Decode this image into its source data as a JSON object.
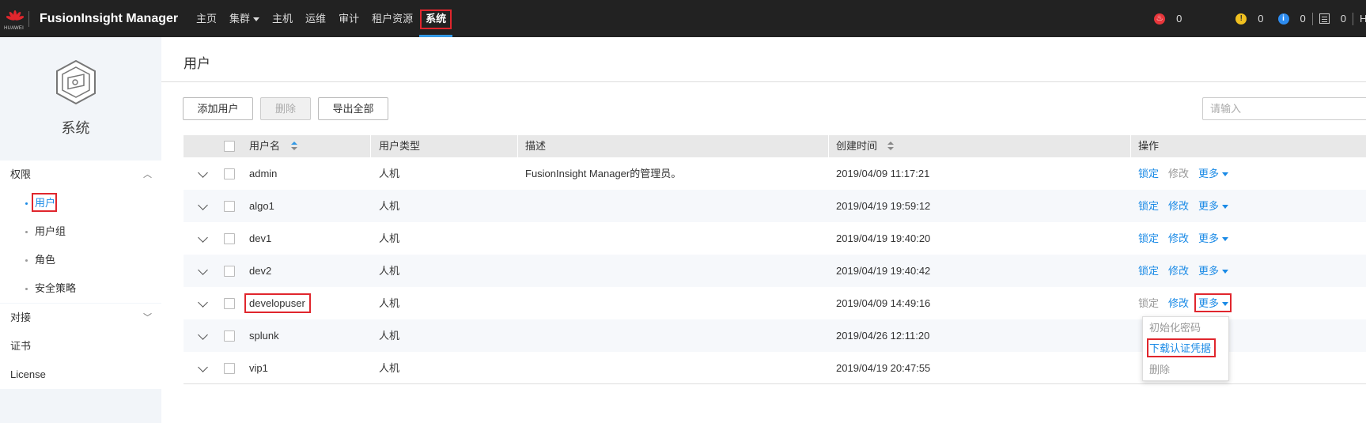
{
  "topbar": {
    "logo_text": "HUAWEI",
    "brand": "FusionInsight Manager",
    "nav": [
      {
        "label": "主页"
      },
      {
        "label": "集群",
        "has_caret": true
      },
      {
        "label": "主机"
      },
      {
        "label": "运维"
      },
      {
        "label": "审计"
      },
      {
        "label": "租户资源"
      },
      {
        "label": "系统",
        "active": true
      }
    ],
    "alarms": [
      {
        "icon": "fire-alarm-icon",
        "color": "#e8363b",
        "count": "0"
      },
      {
        "icon": "warning-alarm-icon",
        "color": "#f0c020",
        "count": "0"
      },
      {
        "icon": "info-alarm-icon",
        "color": "#2d8cf0",
        "count": "0"
      },
      {
        "icon": "task-list-icon",
        "count": "0"
      }
    ],
    "user_initial": "H"
  },
  "sidebar": {
    "title": "系统",
    "sections": [
      {
        "label": "权限",
        "expanded": true,
        "items": [
          "用户",
          "用户组",
          "角色",
          "安全策略"
        ],
        "active_item": "用户"
      },
      {
        "label": "对接",
        "expanded": false
      },
      {
        "label": "证书"
      },
      {
        "label": "License"
      }
    ]
  },
  "main": {
    "title": "用户",
    "toolbar": {
      "add_user": "添加用户",
      "delete": "删除",
      "export_all": "导出全部",
      "search_placeholder": "请输入"
    },
    "table": {
      "columns": [
        "用户名",
        "用户类型",
        "描述",
        "创建时间",
        "操作"
      ],
      "rows": [
        {
          "username": "admin",
          "type": "人机",
          "desc": "FusionInsight Manager的管理员。",
          "created": "2019/04/09 11:17:21"
        },
        {
          "username": "algo1",
          "type": "人机",
          "desc": "",
          "created": "2019/04/19 19:59:12"
        },
        {
          "username": "dev1",
          "type": "人机",
          "desc": "",
          "created": "2019/04/19 19:40:20"
        },
        {
          "username": "dev2",
          "type": "人机",
          "desc": "",
          "created": "2019/04/19 19:40:42"
        },
        {
          "username": "developuser",
          "type": "人机",
          "desc": "",
          "created": "2019/04/09 14:49:16"
        },
        {
          "username": "splunk",
          "type": "人机",
          "desc": "",
          "created": "2019/04/26 12:11:20"
        },
        {
          "username": "vip1",
          "type": "人机",
          "desc": "",
          "created": "2019/04/19 20:47:55"
        }
      ],
      "ops": {
        "lock": "锁定",
        "edit": "修改",
        "more": "更多"
      }
    },
    "dropdown": {
      "items": [
        "初始化密码",
        "下载认证凭据",
        "删除"
      ]
    }
  },
  "colors": {
    "accent": "#1a8ae6",
    "highlight": "#e0262d",
    "topbar": "#222222"
  }
}
